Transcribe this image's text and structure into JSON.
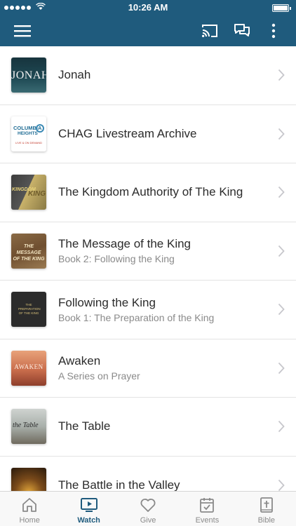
{
  "status_bar": {
    "time": "10:26 AM"
  },
  "app_bar": {
    "menu_icon": "hamburger-menu-icon",
    "cast_icon": "cast-icon",
    "chat_icon": "chat-bubbles-icon",
    "more_icon": "more-vertical-icon"
  },
  "accent_color": "#1f5b7d",
  "list": {
    "items": [
      {
        "title": "Jonah",
        "subtitle": ""
      },
      {
        "title": "CHAG Livestream Archive",
        "subtitle": ""
      },
      {
        "title": "The Kingdom Authority of The King",
        "subtitle": ""
      },
      {
        "title": "The Message of the King",
        "subtitle": "Book 2: Following the King"
      },
      {
        "title": "Following the King",
        "subtitle": "Book 1: The Preparation of the King"
      },
      {
        "title": "Awaken",
        "subtitle": "A Series on Prayer"
      },
      {
        "title": "The Table",
        "subtitle": ""
      },
      {
        "title": "The Battle in the Valley",
        "subtitle": ""
      }
    ],
    "thumbnails": {
      "jonah": "JONAH",
      "chag_line1": "COLUMBIA",
      "chag_line2": "HEIGHTS",
      "chag_line3": "LIVE & ON DEMAND",
      "kingdom": "KINGDOM",
      "kingdom_king": "KING",
      "message": "THE MESSAGE OF THE KING",
      "following": "THE PREPARATION OF THE KING",
      "awaken": "AWAKEN",
      "table": "the Table"
    }
  },
  "tab_bar": {
    "tabs": [
      {
        "label": "Home",
        "icon": "home-icon"
      },
      {
        "label": "Watch",
        "icon": "tv-play-icon",
        "active": true
      },
      {
        "label": "Give",
        "icon": "heart-icon"
      },
      {
        "label": "Events",
        "icon": "calendar-check-icon"
      },
      {
        "label": "Bible",
        "icon": "bible-cross-icon"
      }
    ]
  }
}
